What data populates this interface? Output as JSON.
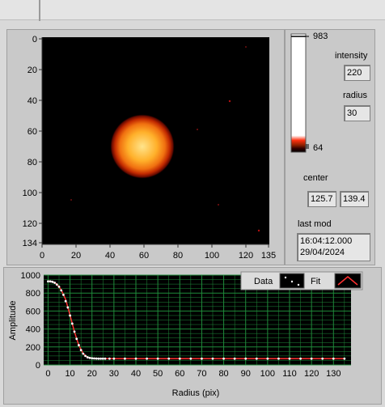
{
  "image_plot": {
    "y_ticks": [
      "0",
      "20",
      "40",
      "60",
      "80",
      "100",
      "120",
      "134"
    ],
    "x_ticks": [
      "0",
      "20",
      "40",
      "60",
      "80",
      "100",
      "120",
      "135"
    ]
  },
  "colorbar": {
    "max_label": "983",
    "min_label": "64"
  },
  "controls": {
    "intensity_label": "intensity",
    "intensity_value": "220",
    "radius_label": "radius",
    "radius_value": "30",
    "center_label": "center",
    "center_x": "125.7",
    "center_y": "139.4",
    "last_mod_label": "last mod",
    "last_mod_time": "16:04:12.000",
    "last_mod_date": "29/04/2024"
  },
  "legend": {
    "data_label": "Data",
    "fit_label": "Fit"
  },
  "colors": {
    "data_marker": "#ffffff",
    "fit_line": "#ff3030",
    "plot_bg": "#000000",
    "grid": "#1f8a3a"
  },
  "chart_data": {
    "type": "scatter",
    "xlabel": "Radius (pix)",
    "ylabel": "Amplitude",
    "xlim": [
      -2,
      138
    ],
    "ylim": [
      0,
      1000
    ],
    "x_ticks": [
      "0",
      "10",
      "20",
      "30",
      "40",
      "50",
      "60",
      "70",
      "80",
      "90",
      "100",
      "110",
      "120",
      "130"
    ],
    "y_ticks": [
      "0",
      "200",
      "400",
      "600",
      "800",
      "1000"
    ],
    "grid": true,
    "legend_position": "top-right",
    "series": [
      {
        "name": "Data",
        "x": [
          0,
          1,
          2,
          3,
          4,
          5,
          6,
          7,
          8,
          9,
          10,
          11,
          12,
          13,
          14,
          15,
          16,
          17,
          18,
          19,
          20,
          21,
          22,
          23,
          24,
          25,
          26,
          28,
          30,
          35,
          40,
          45,
          50,
          55,
          60,
          65,
          70,
          75,
          80,
          85,
          90,
          95,
          100,
          105,
          110,
          115,
          120,
          125,
          130,
          135
        ],
        "y": [
          930,
          930,
          925,
          915,
          895,
          870,
          830,
          780,
          710,
          640,
          550,
          460,
          370,
          290,
          220,
          165,
          125,
          100,
          85,
          78,
          74,
          72,
          71,
          70,
          70,
          70,
          70,
          70,
          70,
          70,
          70,
          70,
          70,
          70,
          70,
          70,
          70,
          70,
          70,
          70,
          70,
          70,
          70,
          70,
          70,
          70,
          70,
          70,
          70,
          70
        ]
      },
      {
        "name": "Fit",
        "x": [
          0,
          2,
          4,
          6,
          8,
          10,
          12,
          14,
          16,
          18,
          20,
          22,
          24,
          26,
          30,
          40,
          60,
          80,
          100,
          120,
          135
        ],
        "y": [
          935,
          928,
          900,
          835,
          730,
          555,
          370,
          220,
          125,
          85,
          74,
          71,
          70,
          70,
          70,
          70,
          70,
          70,
          70,
          70,
          70
        ]
      }
    ]
  }
}
